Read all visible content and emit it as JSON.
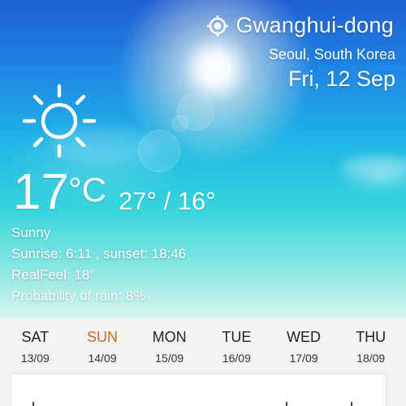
{
  "location": {
    "name": "Gwanghui-dong",
    "region": "Seoul, South Korea",
    "icon": "location-target-icon"
  },
  "date": "Fri, 12 Sep",
  "current": {
    "icon": "sun-icon",
    "temperature": "17",
    "unit": "°C",
    "high_low": "27° / 16°",
    "condition": "Sunny",
    "sun_times": "Sunrise: 6:11 , sunset: 18:46",
    "realfeel": "RealFeel: 18°",
    "rain": "Probability of rain: 8%"
  },
  "forecast": [
    {
      "day": "SAT",
      "date": "13/09"
    },
    {
      "day": "SUN",
      "date": "14/09"
    },
    {
      "day": "MON",
      "date": "15/09"
    },
    {
      "day": "TUE",
      "date": "16/09"
    },
    {
      "day": "WED",
      "date": "17/09"
    },
    {
      "day": "THU",
      "date": "18/09"
    }
  ],
  "colors": {
    "today_highlight": "#d8641e",
    "sky_top": "#1d5fd0",
    "sky_bottom": "#7fe5e0"
  }
}
